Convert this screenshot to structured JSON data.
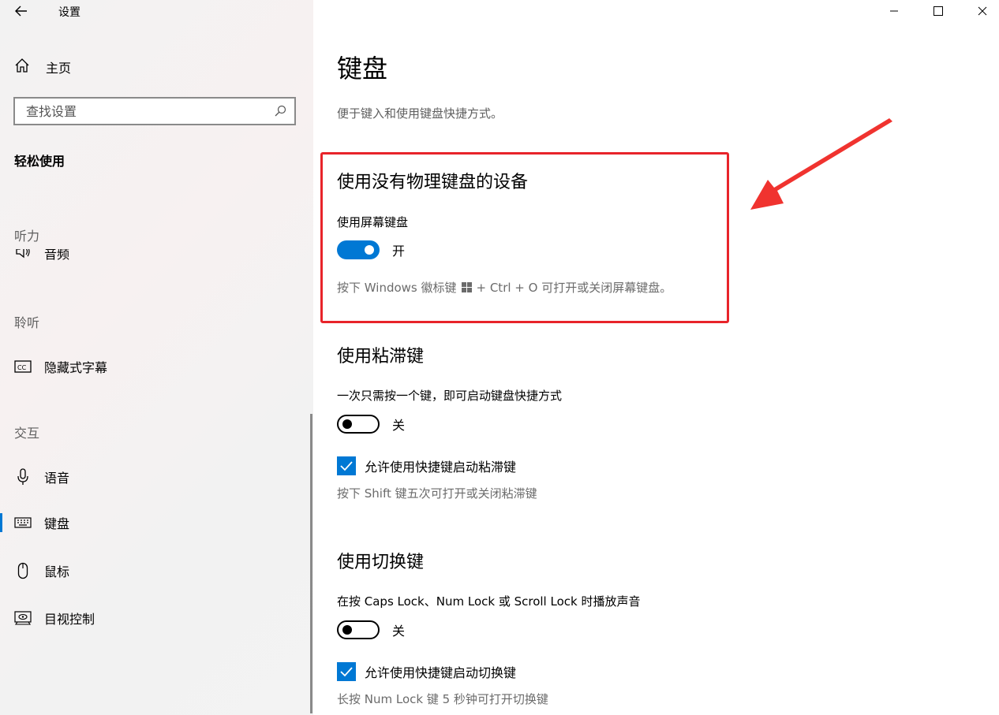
{
  "window": {
    "title": "设置"
  },
  "sidebar": {
    "home_label": "主页",
    "search_placeholder": "查找设置",
    "section_title": "轻松使用",
    "groups": {
      "hearing": "听力",
      "hearing_clipped_item": "音频",
      "listen": "聆听",
      "interaction": "交互"
    },
    "items": {
      "captions": "隐藏式字幕",
      "speech": "语音",
      "keyboard": "键盘",
      "mouse": "鼠标",
      "eye_control": "目视控制"
    },
    "selected_item": "键盘"
  },
  "main": {
    "title": "键盘",
    "description": "便于键入和使用键盘快捷方式。",
    "onscreen": {
      "heading": "使用没有物理键盘的设备",
      "label": "使用屏幕键盘",
      "toggle_state": "开",
      "toggle_on": true,
      "hint_prefix": "按下 Windows 徽标键",
      "hint_suffix": "+ Ctrl + O 可打开或关闭屏幕键盘。"
    },
    "sticky": {
      "heading": "使用粘滞键",
      "label": "一次只需按一个键，即可启动键盘快捷方式",
      "toggle_state": "关",
      "toggle_on": false,
      "checkbox_label": "允许使用快捷键启动粘滞键",
      "checkbox_checked": true,
      "hint": "按下 Shift 键五次可打开或关闭粘滞键"
    },
    "toggle_keys": {
      "heading": "使用切换键",
      "label": "在按 Caps Lock、Num Lock 或 Scroll Lock 时播放声音",
      "toggle_state": "关",
      "toggle_on": false,
      "checkbox_label": "允许使用快捷键启动切换键",
      "checkbox_checked": true,
      "hint": "长按 Num Lock 键 5 秒钟可打开切换键"
    }
  },
  "colors": {
    "accent": "#0078d4",
    "highlight": "#e8242a",
    "arrow": "#f0332f"
  }
}
